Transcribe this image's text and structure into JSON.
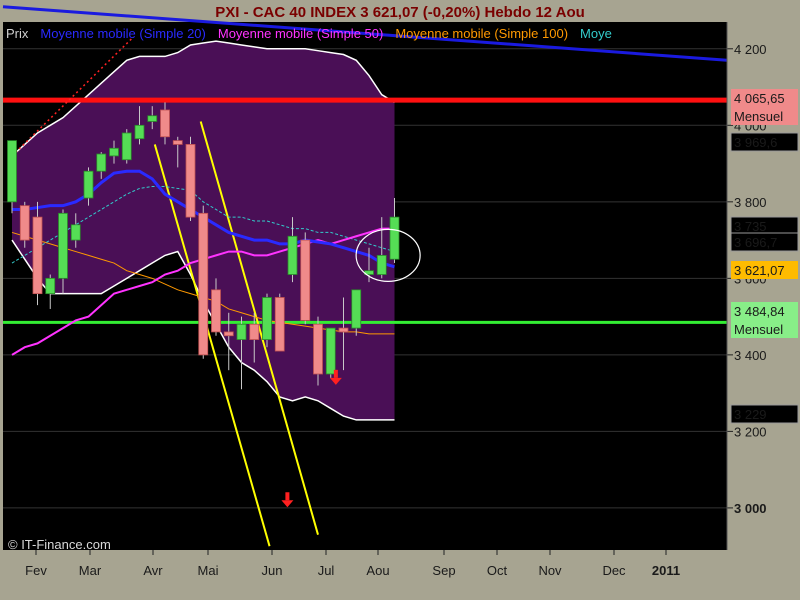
{
  "chart_data": {
    "type": "candlestick",
    "title": "PXI - CAC 40 INDEX     3 621,07 (-0,20%)     Hebdo  12 Aou",
    "legend": [
      {
        "name": "Prix",
        "color": "#d0d0d0"
      },
      {
        "name": "Moyenne mobile (Simple 20)",
        "color": "#2a2aff"
      },
      {
        "name": "Moyenne mobile (Simple 50)",
        "color": "#ff33ff"
      },
      {
        "name": "Moyenne mobile (Simple 100)",
        "color": "#ff9900"
      },
      {
        "name": "Moye",
        "color": "#33cccc"
      }
    ],
    "months": [
      "Fev",
      "Mar",
      "Avr",
      "Mai",
      "Jun",
      "Jul",
      "Aou",
      "Sep",
      "Oct",
      "Nov",
      "Dec",
      "2011"
    ],
    "y_ticks": [
      "4 200",
      "4 000",
      "3 800",
      "3 600",
      "3 400",
      "3 200",
      "3 000"
    ],
    "y_tick_values": [
      4200,
      4000,
      3800,
      3600,
      3400,
      3200,
      3000
    ],
    "ylim": [
      2890,
      4270
    ],
    "candles": [
      {
        "w": 0,
        "o": 3800,
        "h": 3930,
        "l": 3770,
        "c": 3960
      },
      {
        "w": 1,
        "o": 3790,
        "h": 3800,
        "l": 3680,
        "c": 3700
      },
      {
        "w": 2,
        "o": 3760,
        "h": 3800,
        "l": 3530,
        "c": 3560
      },
      {
        "w": 3,
        "o": 3560,
        "h": 3610,
        "l": 3520,
        "c": 3600
      },
      {
        "w": 4,
        "o": 3600,
        "h": 3780,
        "l": 3560,
        "c": 3770
      },
      {
        "w": 5,
        "o": 3700,
        "h": 3770,
        "l": 3680,
        "c": 3740
      },
      {
        "w": 6,
        "o": 3810,
        "h": 3890,
        "l": 3790,
        "c": 3880
      },
      {
        "w": 7,
        "o": 3880,
        "h": 3930,
        "l": 3860,
        "c": 3925
      },
      {
        "w": 8,
        "o": 3920,
        "h": 3960,
        "l": 3900,
        "c": 3940
      },
      {
        "w": 9,
        "o": 3910,
        "h": 3990,
        "l": 3900,
        "c": 3980
      },
      {
        "w": 10,
        "o": 3965,
        "h": 4050,
        "l": 3950,
        "c": 4000
      },
      {
        "w": 11,
        "o": 4010,
        "h": 4050,
        "l": 3990,
        "c": 4025
      },
      {
        "w": 12,
        "o": 4040,
        "h": 4060,
        "l": 3950,
        "c": 3970
      },
      {
        "w": 13,
        "o": 3960,
        "h": 3970,
        "l": 3890,
        "c": 3950
      },
      {
        "w": 14,
        "o": 3950,
        "h": 3970,
        "l": 3750,
        "c": 3760
      },
      {
        "w": 15,
        "o": 3770,
        "h": 3790,
        "l": 3390,
        "c": 3400
      },
      {
        "w": 16,
        "o": 3570,
        "h": 3600,
        "l": 3450,
        "c": 3460
      },
      {
        "w": 17,
        "o": 3460,
        "h": 3510,
        "l": 3360,
        "c": 3450
      },
      {
        "w": 18,
        "o": 3440,
        "h": 3500,
        "l": 3310,
        "c": 3480
      },
      {
        "w": 19,
        "o": 3480,
        "h": 3510,
        "l": 3380,
        "c": 3440
      },
      {
        "w": 20,
        "o": 3440,
        "h": 3560,
        "l": 3420,
        "c": 3550
      },
      {
        "w": 21,
        "o": 3550,
        "h": 3560,
        "l": 3420,
        "c": 3410
      },
      {
        "w": 22,
        "o": 3610,
        "h": 3760,
        "l": 3590,
        "c": 3710
      },
      {
        "w": 23,
        "o": 3700,
        "h": 3720,
        "l": 3480,
        "c": 3490
      },
      {
        "w": 24,
        "o": 3480,
        "h": 3500,
        "l": 3320,
        "c": 3350
      },
      {
        "w": 25,
        "o": 3350,
        "h": 3440,
        "l": 3340,
        "c": 3470
      },
      {
        "w": 26,
        "o": 3470,
        "h": 3550,
        "l": 3360,
        "c": 3460
      },
      {
        "w": 27,
        "o": 3470,
        "h": 3560,
        "l": 3450,
        "c": 3570
      },
      {
        "w": 28,
        "o": 3610,
        "h": 3680,
        "l": 3590,
        "c": 3620
      },
      {
        "w": 29,
        "o": 3610,
        "h": 3760,
        "l": 3600,
        "c": 3660
      },
      {
        "w": 30,
        "o": 3650,
        "h": 3810,
        "l": 3640,
        "c": 3760
      }
    ],
    "ma20": [
      3780,
      3780,
      3785,
      3790,
      3790,
      3800,
      3820,
      3850,
      3875,
      3880,
      3880,
      3860,
      3820,
      3800,
      3780,
      3760,
      3740,
      3720,
      3710,
      3700,
      3700,
      3690,
      3690,
      3700,
      3695,
      3690,
      3680,
      3670,
      3660,
      3640,
      3630
    ],
    "ma50": [
      3400,
      3420,
      3430,
      3450,
      3470,
      3490,
      3500,
      3530,
      3560,
      3570,
      3580,
      3590,
      3610,
      3620,
      3640,
      3650,
      3660,
      3670,
      3670,
      3660,
      3660,
      3670,
      3680,
      3690,
      3700,
      3690,
      3700,
      3710,
      3720,
      3730,
      3730
    ],
    "ma100": [
      3720,
      3710,
      3700,
      3690,
      3680,
      3670,
      3660,
      3650,
      3640,
      3620,
      3610,
      3600,
      3585,
      3570,
      3560,
      3550,
      3540,
      3520,
      3510,
      3500,
      3490,
      3485,
      3480,
      3475,
      3470,
      3465,
      3460,
      3460,
      3455,
      3455,
      3455
    ],
    "ma_cyan": [
      3640,
      3660,
      3680,
      3700,
      3720,
      3740,
      3760,
      3780,
      3800,
      3820,
      3835,
      3840,
      3840,
      3835,
      3830,
      3800,
      3780,
      3760,
      3760,
      3750,
      3750,
      3740,
      3730,
      3730,
      3720,
      3720,
      3710,
      3700,
      3690,
      3680,
      3670
    ],
    "bollinger_upper": [
      3920,
      3950,
      3980,
      4000,
      4020,
      4050,
      4080,
      4110,
      4140,
      4170,
      4180,
      4180,
      4180,
      4190,
      4210,
      4215,
      4220,
      4215,
      4210,
      4205,
      4200,
      4200,
      4200,
      4200,
      4195,
      4190,
      4185,
      4170,
      4130,
      4080,
      4060
    ],
    "bollinger_lower": [
      3700,
      3650,
      3600,
      3560,
      3560,
      3560,
      3560,
      3560,
      3580,
      3600,
      3620,
      3640,
      3660,
      3670,
      3610,
      3540,
      3480,
      3420,
      3380,
      3360,
      3330,
      3290,
      3280,
      3290,
      3280,
      3260,
      3240,
      3230,
      3230,
      3230,
      3230
    ],
    "resistance_blue": {
      "start": 4310,
      "end": 4170
    },
    "red_line": {
      "value": 4065.65
    },
    "green_line": {
      "value": 3484.84
    },
    "price_labels": [
      {
        "text": "4 065,65",
        "bg": "#f08a8a",
        "value": 4065.65
      },
      {
        "text": "Mensuel",
        "bg": "#f08a8a",
        "value": 4065.65
      },
      {
        "text": "3 969,6",
        "bg": "#000000",
        "value": 3969.6
      },
      {
        "text": "3 735",
        "bg": "#000000",
        "value": 3735
      },
      {
        "text": "3 696,7",
        "bg": "#000000",
        "value": 3696.7
      },
      {
        "text": "3 621,07",
        "bg": "#ffbb00",
        "value": 3621.07
      },
      {
        "text": "3 484,84",
        "bg": "#88ee88",
        "value": 3484.84
      },
      {
        "text": "Mensuel",
        "bg": "#88ee88",
        "value": 3484.84
      },
      {
        "text": "3 229",
        "bg": "#000000",
        "value": 3229
      }
    ],
    "copyright": "© IT-Finance.com"
  }
}
